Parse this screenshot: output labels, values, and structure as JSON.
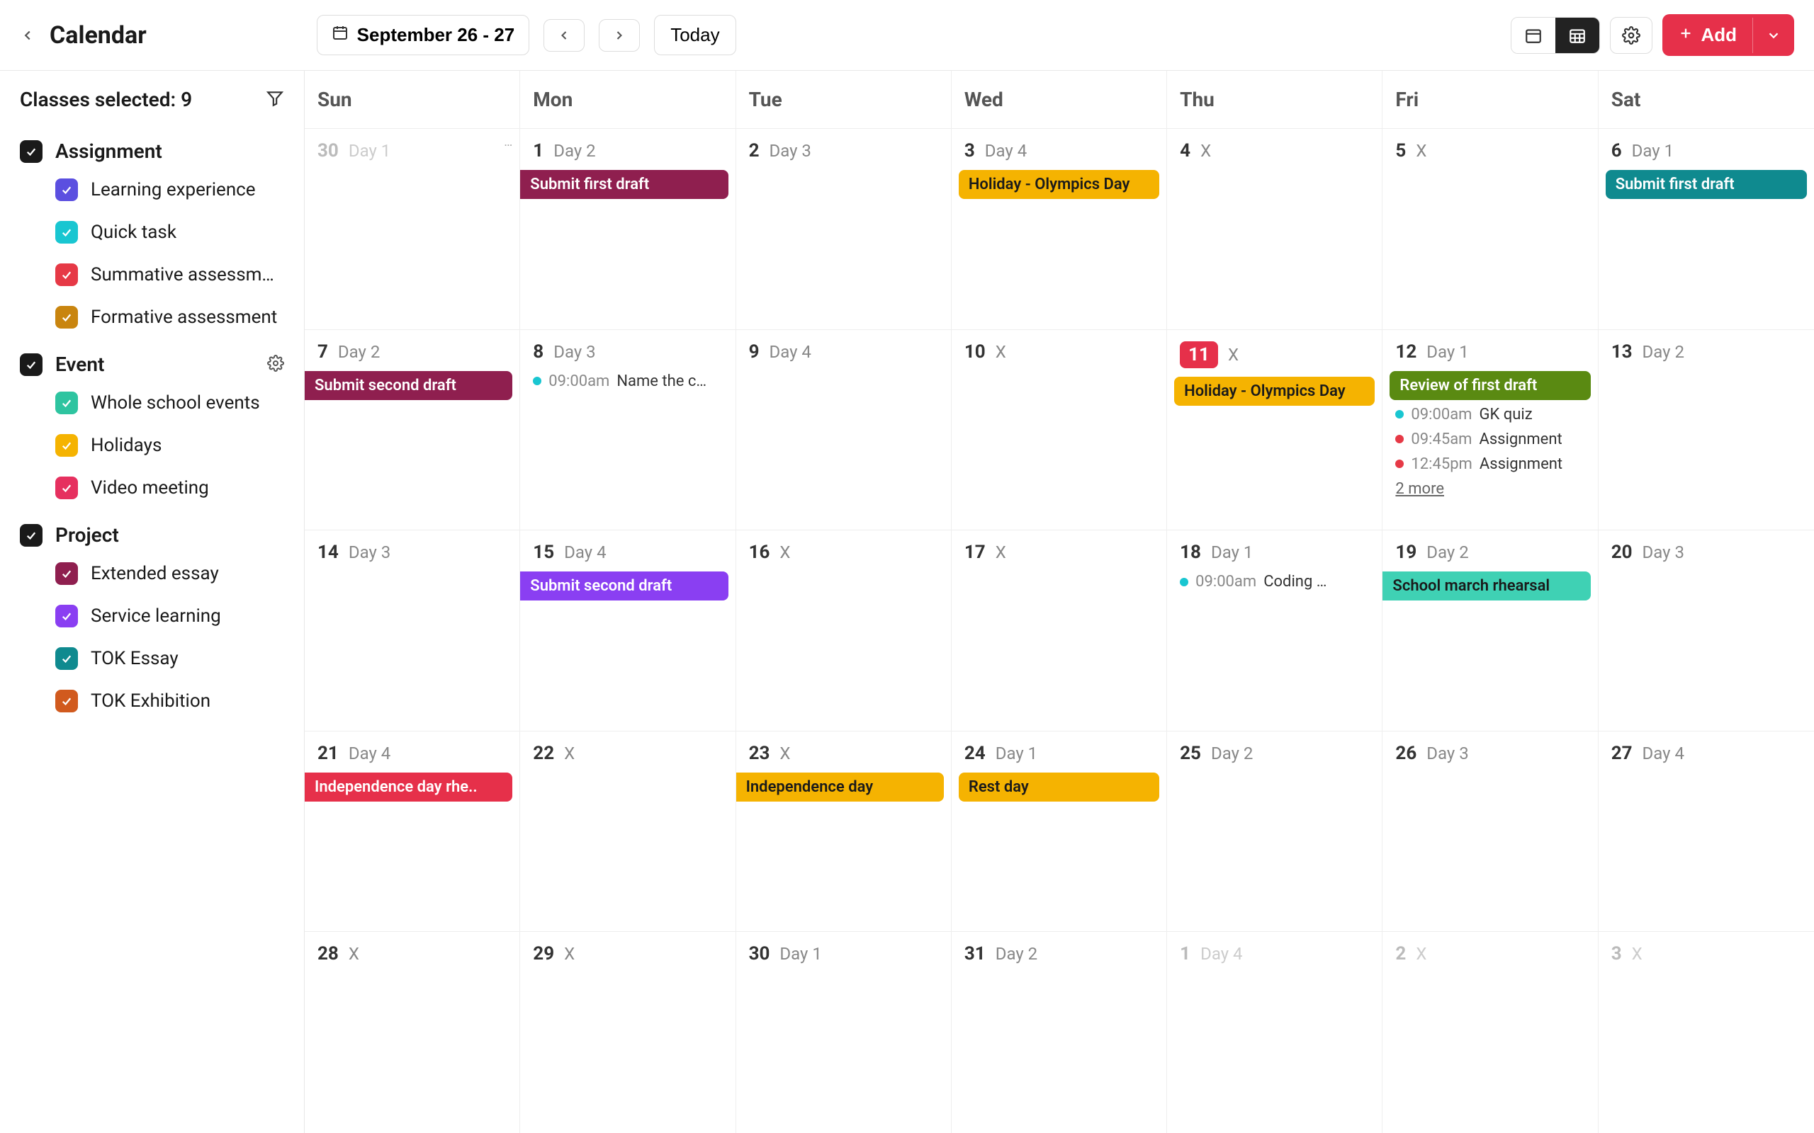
{
  "header": {
    "title": "Calendar",
    "date_range": "September 26 - 27",
    "today_label": "Today",
    "add_label": "Add"
  },
  "sidebar": {
    "classes_selected_label": "Classes selected: 9",
    "groups": [
      {
        "name": "Assignment",
        "has_settings": false,
        "items": [
          {
            "label": "Learning experience",
            "color": "#5b4fe0"
          },
          {
            "label": "Quick task",
            "color": "#19c6d1"
          },
          {
            "label": "Summative assessm…",
            "color": "#e63946"
          },
          {
            "label": "Formative assessment",
            "color": "#c9850f"
          }
        ]
      },
      {
        "name": "Event",
        "has_settings": true,
        "items": [
          {
            "label": "Whole school events",
            "color": "#2ec4a0"
          },
          {
            "label": "Holidays",
            "color": "#f5b301"
          },
          {
            "label": "Video meeting",
            "color": "#e6305f"
          }
        ]
      },
      {
        "name": "Project",
        "has_settings": false,
        "items": [
          {
            "label": "Extended essay",
            "color": "#8f1f4f"
          },
          {
            "label": "Service learning",
            "color": "#8a3ff2"
          },
          {
            "label": "TOK Essay",
            "color": "#0f8a8f"
          },
          {
            "label": "TOK Exhibition",
            "color": "#d15a1e"
          }
        ]
      }
    ]
  },
  "calendar": {
    "day_names": [
      "Sun",
      "Mon",
      "Tue",
      "Wed",
      "Thu",
      "Fri",
      "Sat"
    ],
    "weeks": [
      [
        {
          "num": "30",
          "dim": true,
          "day": "Day 1",
          "more_tick": true
        },
        {
          "num": "1",
          "day": "Day 2",
          "events": [
            {
              "type": "chip",
              "text": "Submit first draft",
              "color": "#8f1f4f",
              "bleed": "left"
            }
          ]
        },
        {
          "num": "2",
          "day": "Day 3"
        },
        {
          "num": "3",
          "day": "Day 4",
          "events": [
            {
              "type": "chip",
              "text": "Holiday - Olympics Day",
              "color": "#f5b301",
              "textcolor": "#1a1a1a"
            }
          ]
        },
        {
          "num": "4",
          "day": "X"
        },
        {
          "num": "5",
          "day": "X"
        },
        {
          "num": "6",
          "day": "Day 1",
          "events": [
            {
              "type": "chip",
              "text": "Submit first draft",
              "color": "#0f8a8f"
            }
          ]
        }
      ],
      [
        {
          "num": "7",
          "day": "Day 2",
          "events": [
            {
              "type": "chip",
              "text": "Submit second draft",
              "color": "#8f1f4f",
              "bleed": "left"
            }
          ]
        },
        {
          "num": "8",
          "day": "Day 3",
          "events": [
            {
              "type": "timed",
              "dot": "#19c6d1",
              "time": "09:00am",
              "title": "Name the c…"
            }
          ]
        },
        {
          "num": "9",
          "day": "Day 4"
        },
        {
          "num": "10",
          "day": "X"
        },
        {
          "num": "11",
          "day": "X",
          "highlight": true,
          "events": [
            {
              "type": "chip",
              "text": "Holiday - Olympics Day",
              "color": "#f5b301",
              "textcolor": "#1a1a1a"
            }
          ]
        },
        {
          "num": "12",
          "day": "Day 1",
          "events": [
            {
              "type": "chip",
              "text": "Review of first draft",
              "color": "#5a8a12"
            },
            {
              "type": "timed",
              "dot": "#19c6d1",
              "time": "09:00am",
              "title": "GK quiz"
            },
            {
              "type": "timed",
              "dot": "#e63946",
              "time": "09:45am",
              "title": "Assignment"
            },
            {
              "type": "timed",
              "dot": "#e63946",
              "time": "12:45pm",
              "title": "Assignment"
            }
          ],
          "more": "2 more"
        },
        {
          "num": "13",
          "day": "Day 2"
        }
      ],
      [
        {
          "num": "14",
          "day": "Day 3"
        },
        {
          "num": "15",
          "day": "Day 4",
          "events": [
            {
              "type": "chip",
              "text": "Submit second draft",
              "color": "#8a3ff2",
              "bleed": "left"
            }
          ]
        },
        {
          "num": "16",
          "day": "X"
        },
        {
          "num": "17",
          "day": "X"
        },
        {
          "num": "18",
          "day": "Day 1",
          "events": [
            {
              "type": "timed",
              "dot": "#19c6d1",
              "time": "09:00am",
              "title": "Coding …"
            }
          ]
        },
        {
          "num": "19",
          "day": "Day 2",
          "events": [
            {
              "type": "chip",
              "text": "School march rhearsal",
              "color": "#3fd1b4",
              "textcolor": "#1a1a1a",
              "bleed": "left"
            }
          ]
        },
        {
          "num": "20",
          "day": "Day 3"
        }
      ],
      [
        {
          "num": "21",
          "day": "Day 4",
          "events": [
            {
              "type": "chip",
              "text": "Independence day rhe..",
              "color": "#e6304a",
              "bleed": "left"
            }
          ]
        },
        {
          "num": "22",
          "day": "X"
        },
        {
          "num": "23",
          "day": "X",
          "events": [
            {
              "type": "chip",
              "text": "Independence day",
              "color": "#f5b301",
              "textcolor": "#1a1a1a",
              "bleed": "left"
            }
          ]
        },
        {
          "num": "24",
          "day": "Day 1",
          "events": [
            {
              "type": "chip",
              "text": "Rest day",
              "color": "#f5b301",
              "textcolor": "#1a1a1a"
            }
          ]
        },
        {
          "num": "25",
          "day": "Day 2"
        },
        {
          "num": "26",
          "day": "Day 3"
        },
        {
          "num": "27",
          "day": "Day 4"
        }
      ],
      [
        {
          "num": "28",
          "day": "X"
        },
        {
          "num": "29",
          "day": "X"
        },
        {
          "num": "30",
          "day": "Day  1"
        },
        {
          "num": "31",
          "day": "Day 2"
        },
        {
          "num": "1",
          "dim": true,
          "day": "Day 4"
        },
        {
          "num": "2",
          "dim": true,
          "day": "X"
        },
        {
          "num": "3",
          "dim": true,
          "day": "X"
        }
      ],
      [
        {
          "num": "",
          "day": ""
        },
        {
          "num": "",
          "day": ""
        },
        {
          "num": "",
          "day": ""
        },
        {
          "num": "",
          "day": ""
        },
        {
          "num": "",
          "day": ""
        },
        {
          "num": "",
          "day": ""
        },
        {
          "num": "",
          "day": ""
        }
      ]
    ]
  }
}
